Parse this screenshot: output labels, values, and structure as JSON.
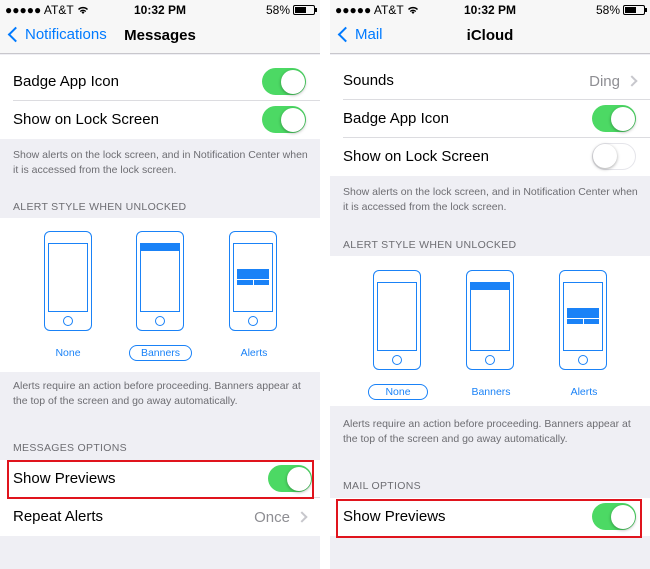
{
  "left": {
    "status": {
      "carrier": "●●●●● AT&T",
      "time": "10:32 PM",
      "battery": "58%"
    },
    "nav": {
      "back": "Notifications",
      "title": "Messages"
    },
    "rows": {
      "badge": "Badge App Icon",
      "lock": "Show on Lock Screen"
    },
    "lock_note": "Show alerts on the lock screen, and in Notification Center when it is accessed from the lock screen.",
    "alert_style_header": "ALERT STYLE WHEN UNLOCKED",
    "styles": {
      "none": "None",
      "banners": "Banners",
      "alerts": "Alerts",
      "selected": "Banners"
    },
    "style_note": "Alerts require an action before proceeding. Banners appear at the top of the screen and go away automatically.",
    "options_header": "MESSAGES OPTIONS",
    "previews": "Show Previews",
    "repeat": {
      "label": "Repeat Alerts",
      "value": "Once"
    },
    "toggles": {
      "badge": true,
      "lock": true,
      "previews": true
    }
  },
  "right": {
    "status": {
      "carrier": "●●●●● AT&T",
      "time": "10:32 PM",
      "battery": "58%"
    },
    "nav": {
      "back": "Mail",
      "title": "iCloud"
    },
    "rows": {
      "sounds": {
        "label": "Sounds",
        "value": "Ding"
      },
      "badge": "Badge App Icon",
      "lock": "Show on Lock Screen"
    },
    "lock_note": "Show alerts on the lock screen, and in Notification Center when it is accessed from the lock screen.",
    "alert_style_header": "ALERT STYLE WHEN UNLOCKED",
    "styles": {
      "none": "None",
      "banners": "Banners",
      "alerts": "Alerts",
      "selected": "None"
    },
    "style_note": "Alerts require an action before proceeding. Banners appear at the top of the screen and go away automatically.",
    "options_header": "MAIL OPTIONS",
    "previews": "Show Previews",
    "toggles": {
      "badge": true,
      "lock": false,
      "previews": true
    }
  },
  "colors": {
    "accent": "#007aff",
    "switch_on": "#4cd964",
    "highlight": "#e0141d"
  }
}
